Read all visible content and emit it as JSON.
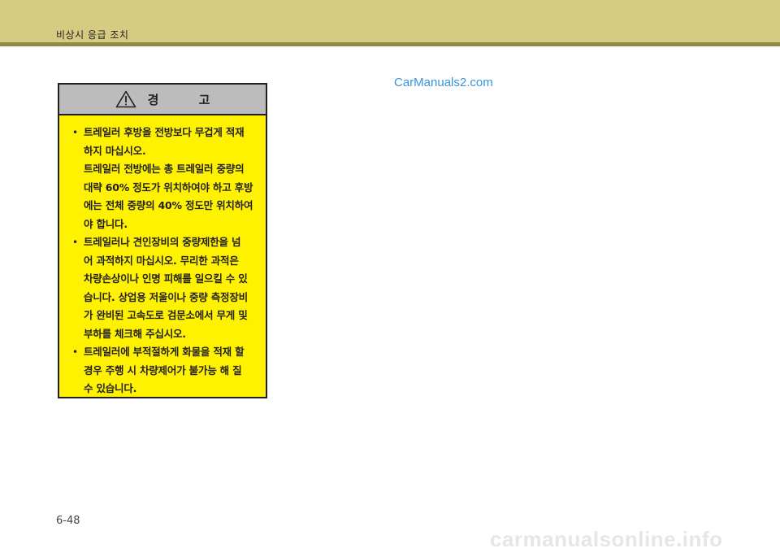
{
  "header": {
    "title": "비상시 응급 조치"
  },
  "watermark": "CarManuals2.com",
  "warning": {
    "title": "경 고",
    "items": [
      {
        "bullet": "•",
        "lines": [
          "트레일러 후방을 전방보다 무겁게 적재",
          "하지 마십시오.",
          "트레일러 전방에는 총 트레일러 중량의",
          "대략 60% 정도가 위치하여야 하고 후방",
          "에는 전체 중량의 40% 정도만 위치하여",
          "야 합니다."
        ]
      },
      {
        "bullet": "•",
        "lines": [
          "트레일러나 견인장비의 중량제한을 넘",
          "어 과적하지 마십시오. 무리한 과적은",
          "차량손상이나 인명 피해를 일으킬 수 있",
          "습니다. 상업용 저울이나 중량 측정장비",
          "가 완비된 고속도로 검문소에서 무게 및",
          "부하를 체크해 주십시오."
        ]
      },
      {
        "bullet": "•",
        "lines": [
          "트레일러에 부적절하게 화물을 적재 할",
          "경우 주행 시 차량제어가 불가능 해 질",
          "수 있습니다."
        ]
      }
    ]
  },
  "footer": {
    "page_number": "6-48",
    "watermark": "carmanualsonline.info"
  },
  "colors": {
    "header_band": "#d6cb80",
    "header_rule": "#8e8a45",
    "warning_bg": "#fff200",
    "warning_head": "#bcbcbc",
    "watermark": "#3a93d9"
  }
}
